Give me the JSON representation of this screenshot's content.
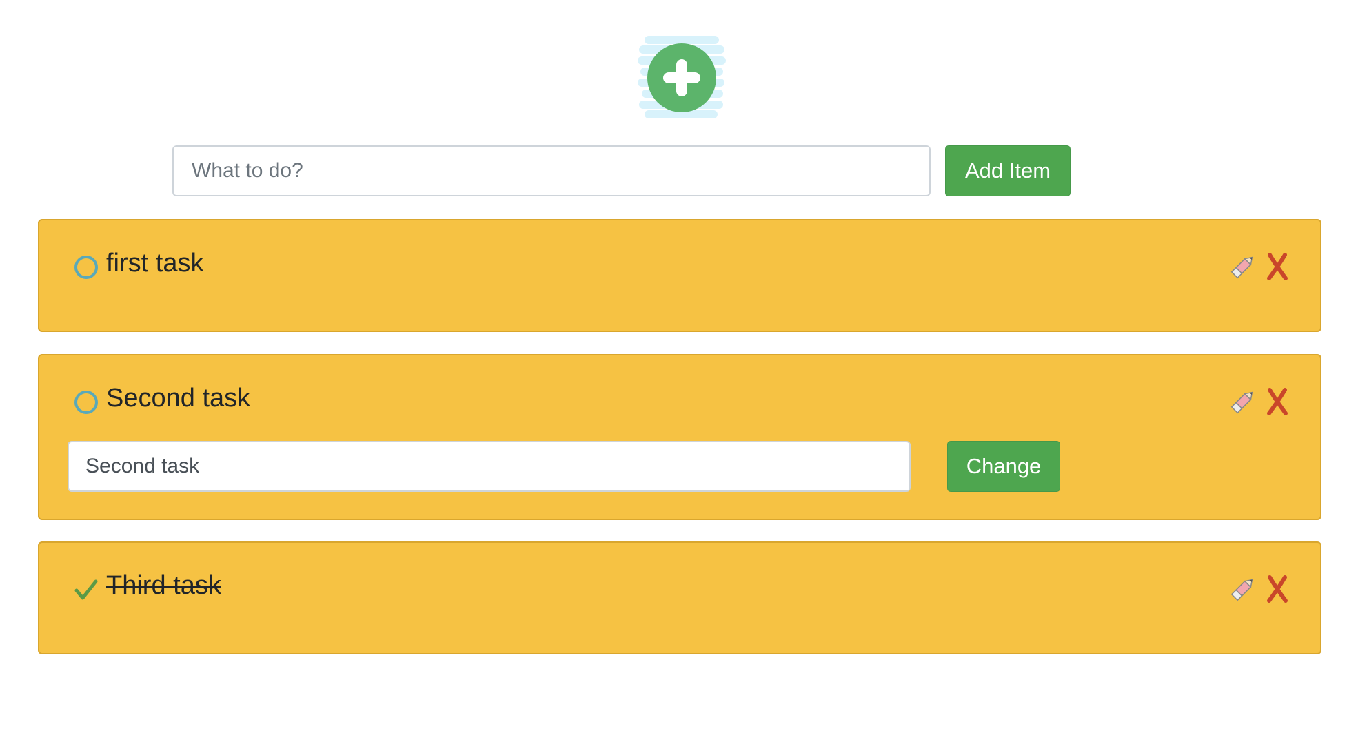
{
  "colors": {
    "accent_green": "#4ea64f",
    "card_background": "#f6c243",
    "card_border": "#d9a62e",
    "logo_green": "#5cb46b",
    "logo_glow": "#d8f2fb",
    "status_circle": "#5aa9b9",
    "check_green": "#5a9a46",
    "pencil_pink": "#f2a6ae",
    "delete_red": "#c9462a"
  },
  "logo": {
    "icon": "plus-circle-icon"
  },
  "add_form": {
    "input_placeholder": "What to do?",
    "input_value": "",
    "button_label": "Add Item"
  },
  "tasks": [
    {
      "title": "first task",
      "completed": false,
      "status_icon": "circle-outline-icon",
      "editing": false,
      "edit_icon": "pencil-icon",
      "delete_icon": "close-x-icon"
    },
    {
      "title": "Second task",
      "completed": false,
      "status_icon": "circle-outline-icon",
      "editing": true,
      "edit_input_value": "Second task",
      "change_button_label": "Change",
      "edit_icon": "pencil-icon",
      "delete_icon": "close-x-icon"
    },
    {
      "title": "Third task",
      "completed": true,
      "status_icon": "checkmark-icon",
      "editing": false,
      "edit_icon": "pencil-icon",
      "delete_icon": "close-x-icon"
    }
  ]
}
